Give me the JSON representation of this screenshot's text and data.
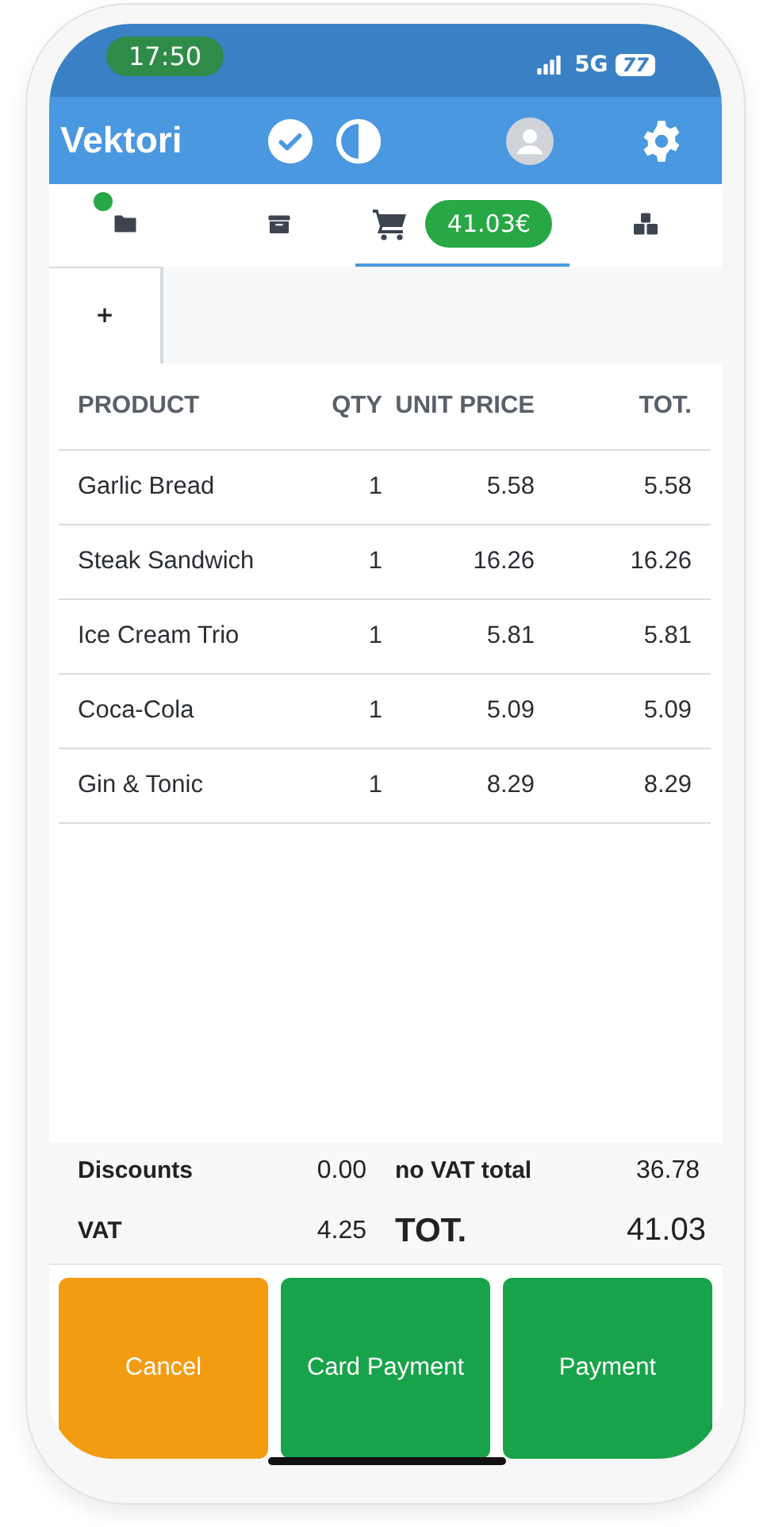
{
  "status_bar": {
    "time": "17:50",
    "network": "5G",
    "battery": "77"
  },
  "app_bar": {
    "title": "Vektori"
  },
  "nav_tabs": [
    {
      "selected": false,
      "indicator": true
    },
    {
      "selected": false,
      "indicator": false
    },
    {
      "selected": true,
      "indicator": false,
      "badge": "41.03€"
    },
    {
      "selected": false,
      "indicator": false
    }
  ],
  "order_tabs": [
    {
      "label": "+",
      "selected": true
    }
  ],
  "table": {
    "columns": [
      "PRODUCT",
      "QTY",
      "UNIT PRICE",
      "TOT."
    ],
    "rows": [
      [
        "Garlic Bread",
        "1",
        "5.58",
        "5.58"
      ],
      [
        "Steak Sandwich",
        "1",
        "16.26",
        "16.26"
      ],
      [
        "Ice Cream Trio",
        "1",
        "5.81",
        "5.81"
      ],
      [
        "Coca-Cola",
        "1",
        "5.09",
        "5.09"
      ],
      [
        "Gin & Tonic",
        "1",
        "8.29",
        "8.29"
      ]
    ]
  },
  "summary": [
    {
      "label": "Discounts",
      "value": "0.00",
      "kind": "normal"
    },
    {
      "label": "no VAT total",
      "value": "36.78",
      "kind": "normal"
    },
    {
      "label": "VAT",
      "value": "4.25",
      "kind": "normal"
    },
    {
      "label": "TOT.",
      "value": "41.03",
      "kind": "large"
    }
  ],
  "buttons": [
    {
      "label": "Cancel",
      "color": "#f39c12"
    },
    {
      "label": "Card Payment",
      "color": "#18a34a"
    },
    {
      "label": "Payment",
      "color": "#18a34a"
    }
  ]
}
